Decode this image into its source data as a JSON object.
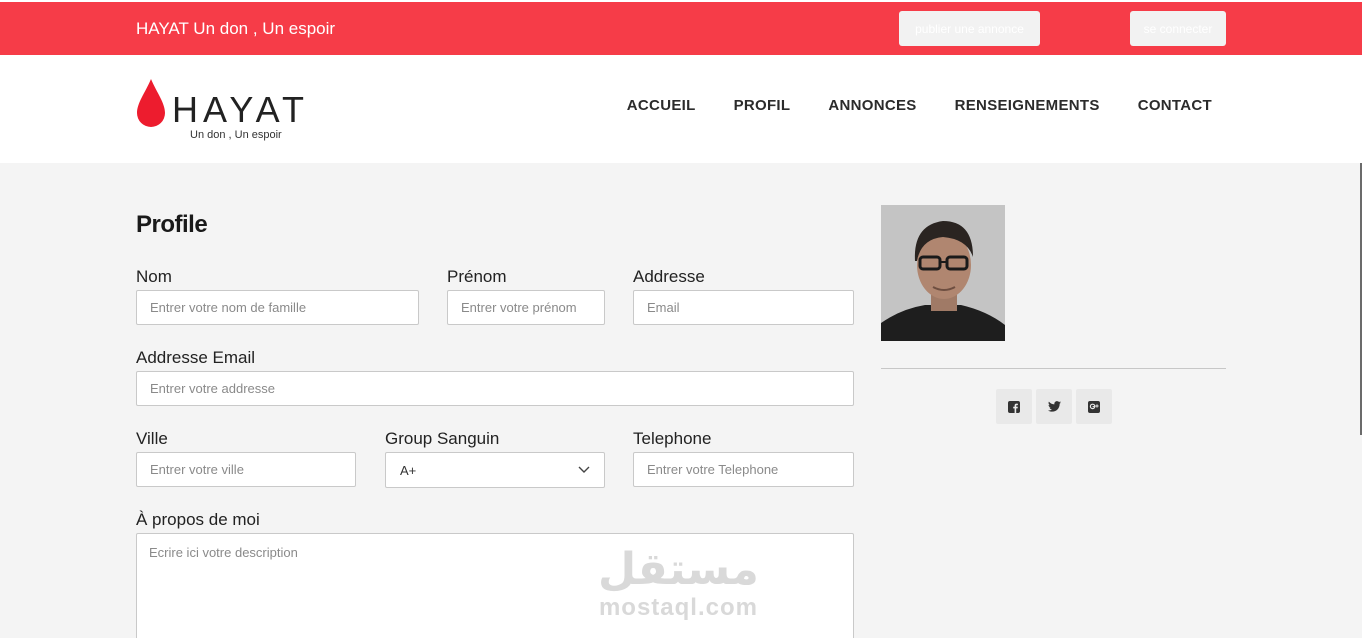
{
  "topbar": {
    "tagline": "HAYAT Un don , Un espoir",
    "post_button": "publier une annonce",
    "login_button": "se connecter",
    "color": "#f63c48"
  },
  "logo": {
    "brand": "HAYAT",
    "sub": "Un don , Un espoir"
  },
  "nav": [
    "ACCUEIL",
    "PROFIL",
    "ANNONCES",
    "RENSEIGNEMENTS",
    "CONTACT"
  ],
  "form": {
    "title": "Profile",
    "nom": {
      "label": "Nom",
      "placeholder": "Entrer votre nom de famille"
    },
    "prenom": {
      "label": "Prénom",
      "placeholder": "Entrer votre prénom"
    },
    "addresse": {
      "label": "Addresse",
      "placeholder": "Email"
    },
    "email": {
      "label": "Addresse Email",
      "placeholder": "Entrer votre addresse"
    },
    "ville": {
      "label": "Ville",
      "placeholder": "Entrer votre ville"
    },
    "group": {
      "label": "Group Sanguin",
      "value": "A+"
    },
    "telephone": {
      "label": "Telephone",
      "placeholder": "Entrer votre Telephone"
    },
    "apropos": {
      "label": "À propos de moi",
      "placeholder": "Ecrire ici votre description"
    }
  },
  "social": [
    "facebook-icon",
    "twitter-icon",
    "google-plus-icon"
  ],
  "watermark": {
    "arabic": "مستقل",
    "latin": "mostaql.com"
  }
}
